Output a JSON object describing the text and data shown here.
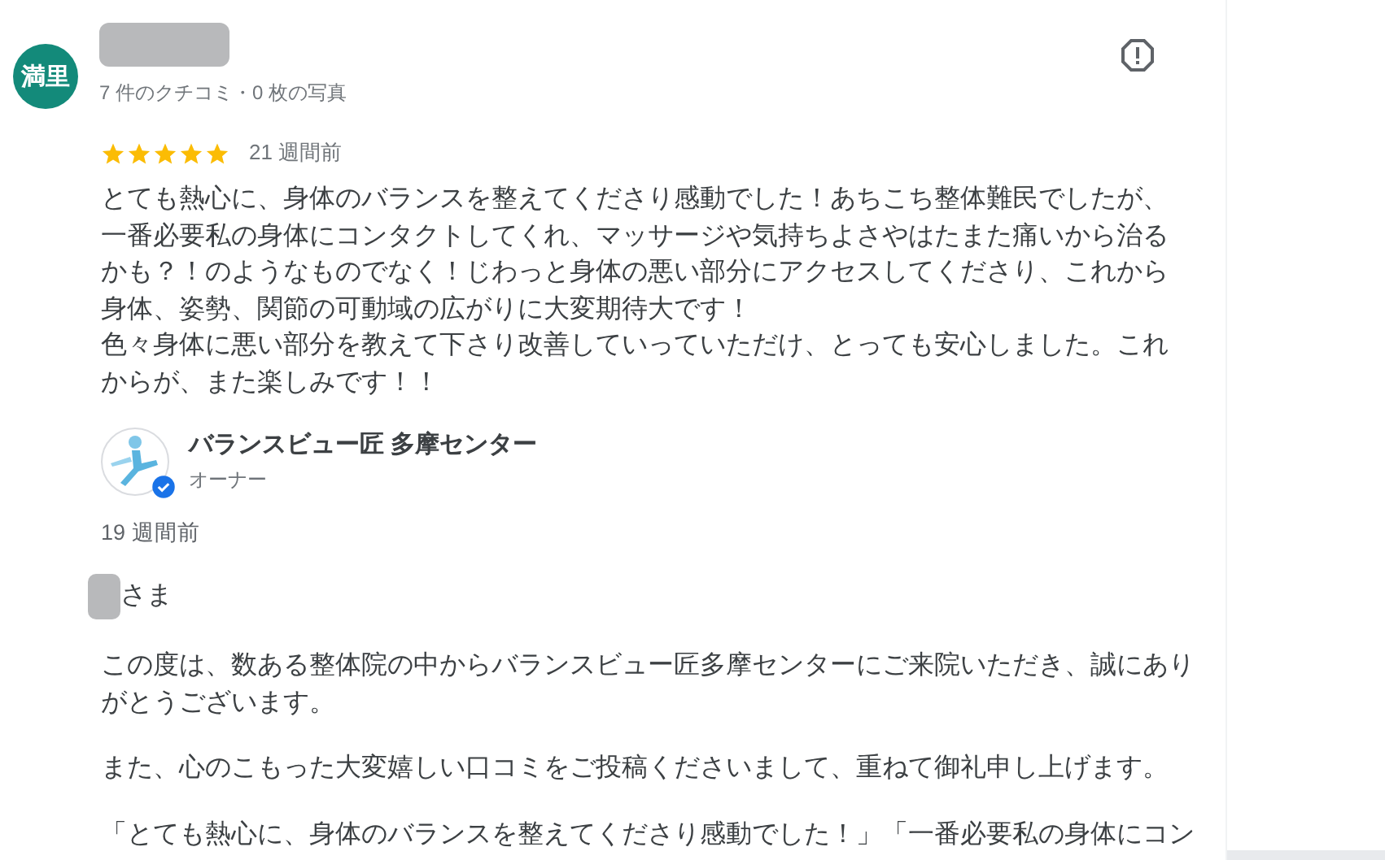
{
  "reviewer": {
    "avatar_text": "満里",
    "name_hidden": true,
    "stats": "7 件のクチコミ・0 枚の写真"
  },
  "review": {
    "stars": 5,
    "time": "21 週間前",
    "paragraphs": [
      "とても熱心に、身体のバランスを整えてくださり感動でした！あちこち整体難民でしたが、一番必要私の身体にコンタクトしてくれ、マッサージや気持ちよさやはたまた痛いから治るかも？！のようなものでなく！じわっと身体の悪い部分にアクセスしてくださり、これから身体、姿勢、関節の可動域の広がりに大変期待大です！",
      "色々身体に悪い部分を教えて下さり改善していっていただけ、とっても安心しました。これからが、また楽しみです！！"
    ]
  },
  "owner_reply": {
    "name": "バランスビュー匠 多摩センター",
    "role": "オーナー",
    "verified": true,
    "time": "19 週間前",
    "greeting": "さま",
    "paragraphs": [
      "この度は、数ある整体院の中からバランスビュー匠多摩センターにご来院いただき、誠にありがとうございます。",
      "また、心のこもった大変嬉しい口コミをご投稿くださいまして、重ねて御礼申し上げます。",
      "「とても熱心に、身体のバランスを整えてくださり感動でした！」「一番必要私の身体にコン"
    ]
  }
}
